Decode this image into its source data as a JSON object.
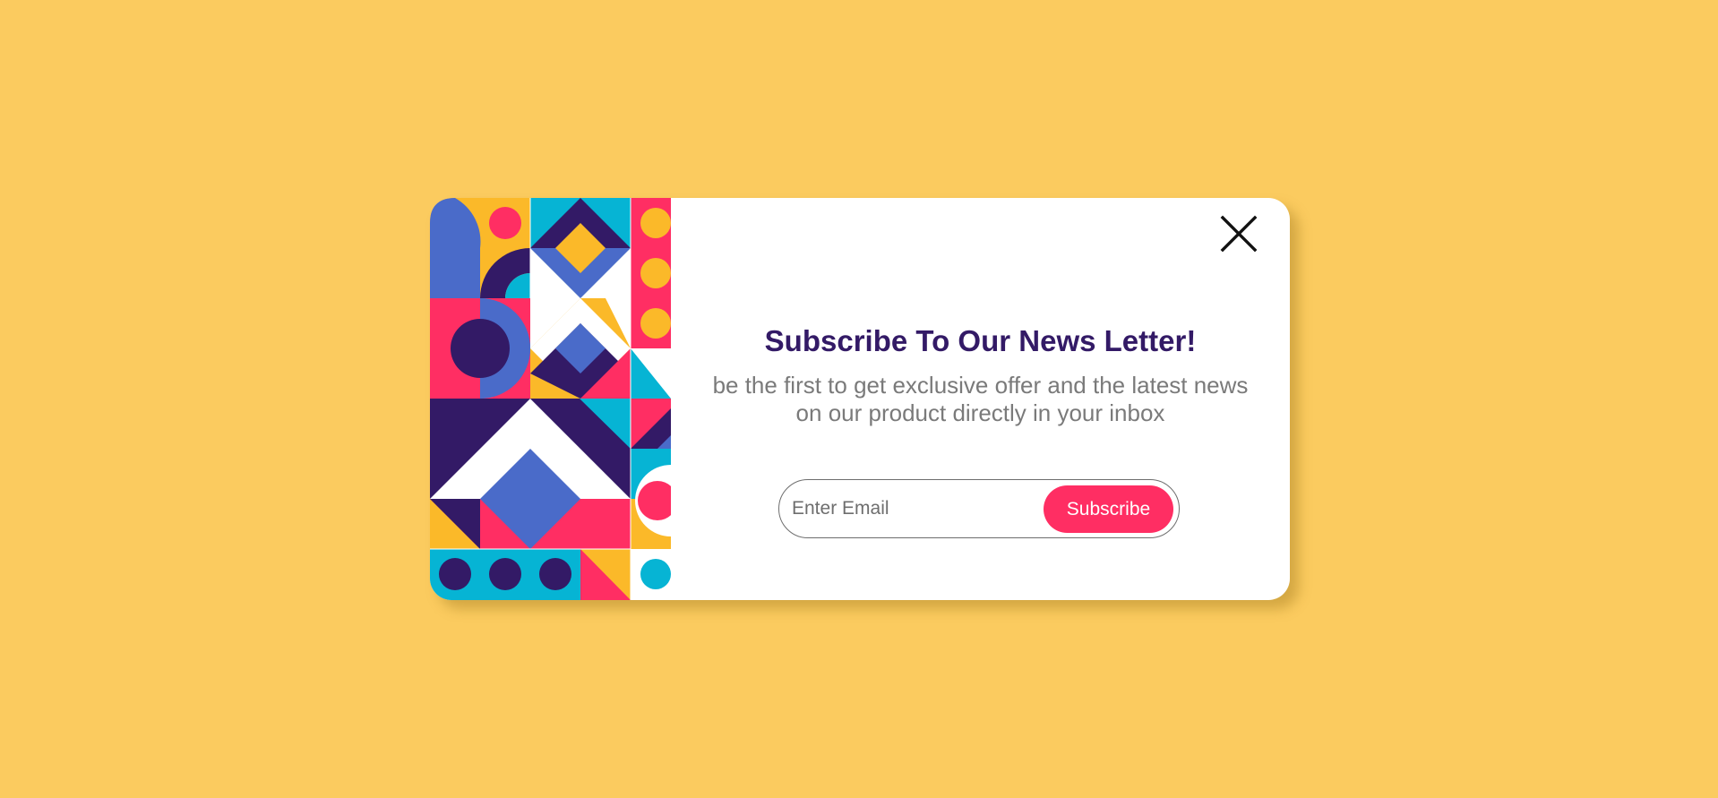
{
  "colors": {
    "background": "#FBCB5F",
    "card": "#FFFFFF",
    "title": "#331A66",
    "subtitle": "#7A7A7A",
    "accent": "#FF2E63",
    "pattern_yellow": "#FBB929",
    "pattern_pink": "#FF2E63",
    "pattern_blue": "#4A6BC9",
    "pattern_purple": "#331A66",
    "pattern_cyan": "#06B4D4"
  },
  "modal": {
    "close_icon": "close-icon",
    "title": "Subscribe To Our News Letter!",
    "subtitle": "be the first to get exclusive offer and the latest news on our product directly in your inbox",
    "email_placeholder": "Enter Email",
    "email_value": "",
    "subscribe_label": "Subscribe"
  }
}
